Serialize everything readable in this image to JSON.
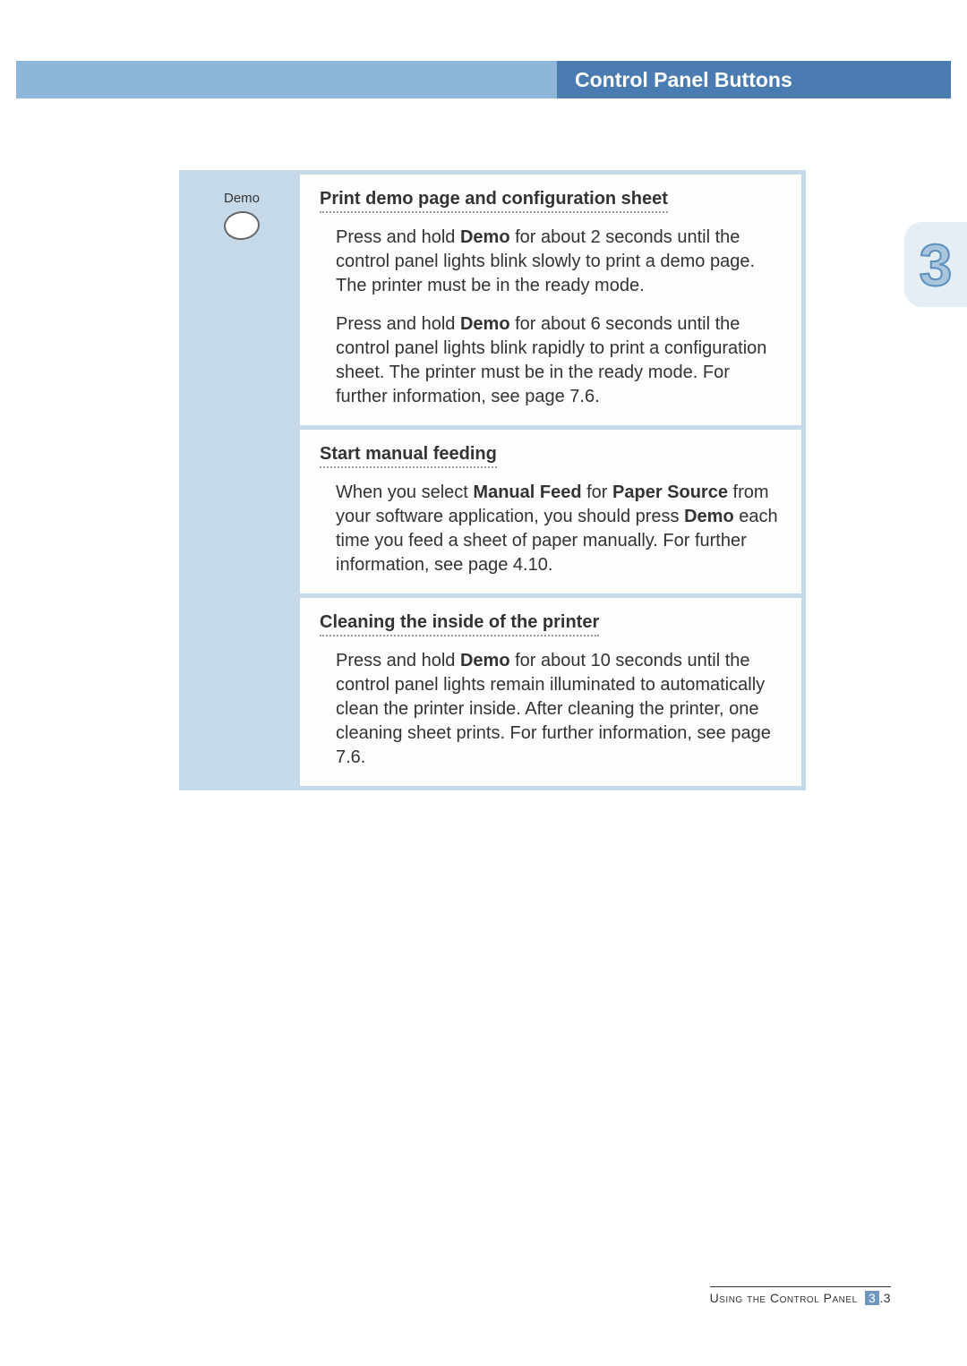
{
  "header": {
    "title": "Control Panel Buttons"
  },
  "tab": {
    "number": "3"
  },
  "demo_label": "Demo",
  "sections": [
    {
      "heading": "Print demo page and configuration sheet",
      "paragraphs": [
        {
          "pre": "Press and hold ",
          "bold1": "Demo",
          "post1": " for about 2 seconds until the control panel lights blink slowly to print a demo page. The printer must be in the ready mode."
        },
        {
          "pre": "Press and hold ",
          "bold1": "Demo",
          "post1": " for about 6 seconds until the control panel lights blink rapidly to print a configuration sheet. The printer must be in the ready mode. For further information, see page 7.6."
        }
      ]
    },
    {
      "heading": "Start manual feeding",
      "paragraphs": [
        {
          "pre": "When you select ",
          "bold1": "Manual Feed",
          "mid1": " for ",
          "bold2": "Paper Source",
          "mid2": " from your software application, you should press ",
          "bold3": "Demo",
          "post1": " each time you feed a sheet of paper manually. For further information, see page 4.10."
        }
      ]
    },
    {
      "heading": "Cleaning the inside of the printer",
      "paragraphs": [
        {
          "pre": "Press and hold ",
          "bold1": "Demo",
          "post1": " for about 10 seconds until the control panel lights remain illuminated to automatically clean the printer inside. After cleaning the printer, one cleaning sheet prints. For further information, see page 7.6."
        }
      ]
    }
  ],
  "footer": {
    "text": "Using the Control Panel",
    "page_section": "3",
    "page_num": ".3"
  }
}
